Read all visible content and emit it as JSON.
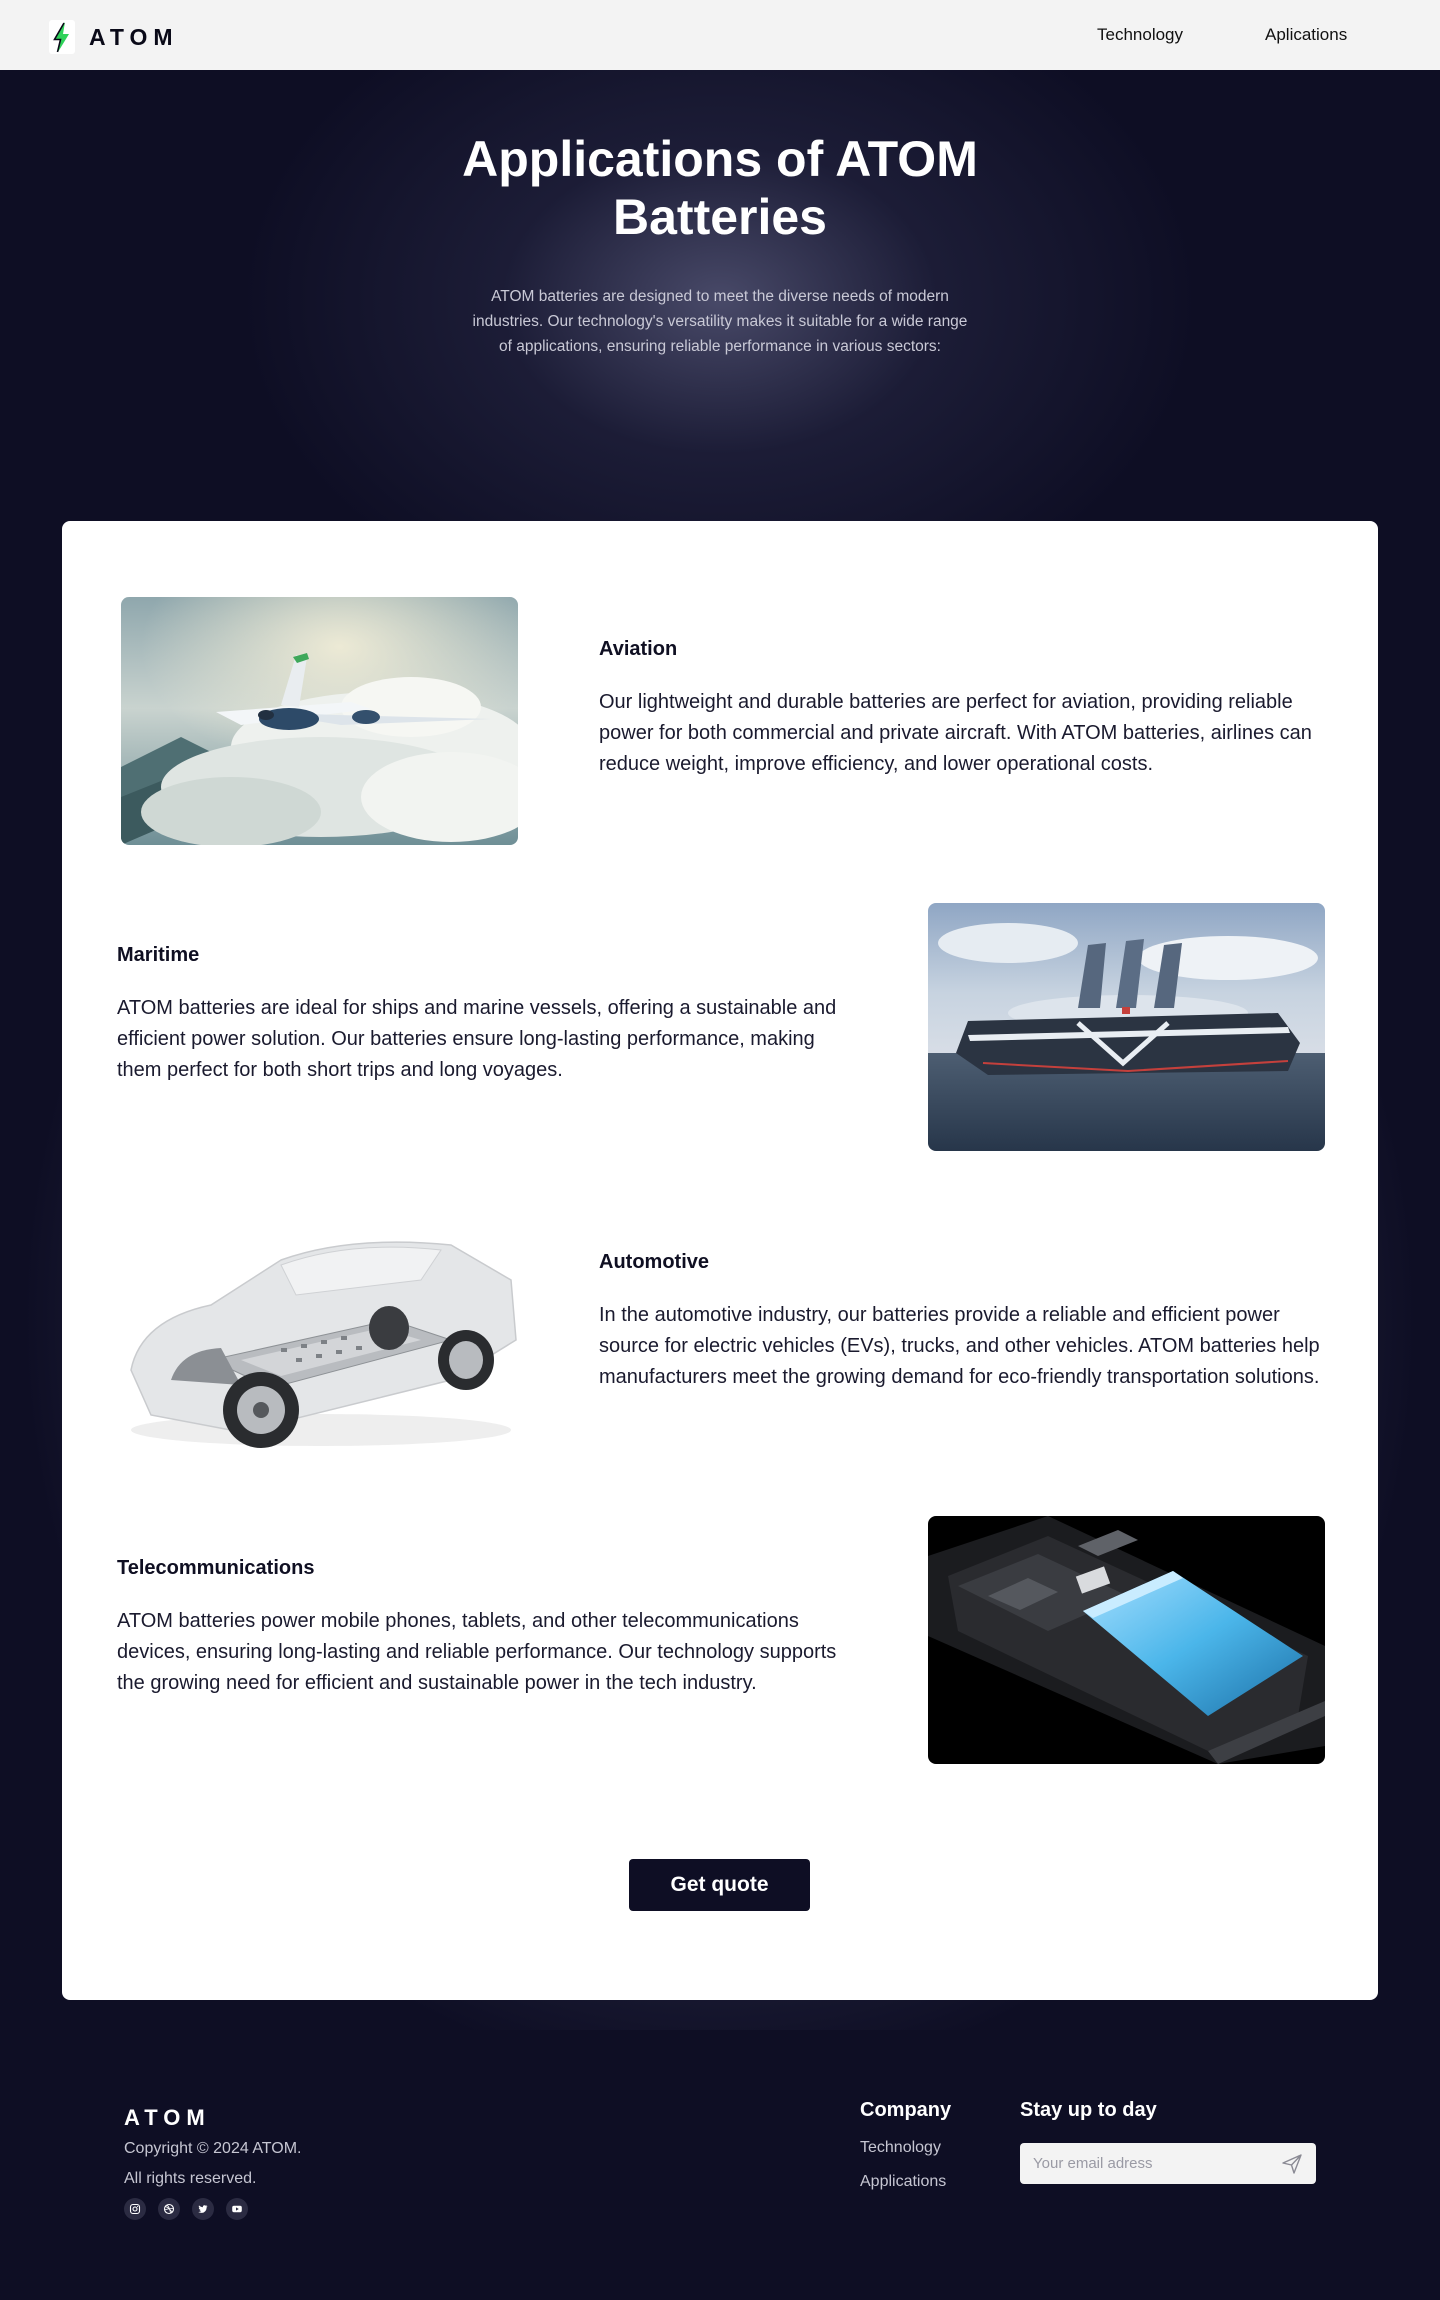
{
  "header": {
    "logo_text": "ATOM",
    "logo_icon": "lightning-bolt-icon",
    "nav": [
      "Technology",
      "Aplications"
    ]
  },
  "hero": {
    "title": "Applications of ATOM Batteries",
    "description": "ATOM batteries are designed to meet the diverse needs of modern industries. Our technology's versatility makes it suitable for a wide range of applications, ensuring reliable performance in various sectors:"
  },
  "sections": [
    {
      "title": "Aviation",
      "body": "Our lightweight and durable batteries are perfect for aviation, providing reliable power for both commercial and private aircraft. With ATOM batteries, airlines can reduce weight, improve efficiency, and lower operational costs.",
      "image": "electric-aircraft-image"
    },
    {
      "title": "Maritime",
      "body": "ATOM batteries are ideal for ships and marine vessels, offering a sustainable and efficient power solution. Our batteries ensure long-lasting performance, making them perfect for both short trips and long voyages.",
      "image": "electric-ship-image"
    },
    {
      "title": "Automotive",
      "body": "In the automotive industry, our batteries provide a reliable and efficient power source for electric vehicles (EVs), trucks, and other vehicles. ATOM batteries help manufacturers meet the growing demand for eco-friendly transportation solutions.",
      "image": "electric-car-chassis-image"
    },
    {
      "title": "Telecommunications",
      "body": "ATOM batteries power mobile phones, tablets, and other telecommunications devices, ensuring long-lasting and reliable performance. Our technology supports the growing need for efficient and sustainable power in the tech industry.",
      "image": "smartphone-battery-image"
    }
  ],
  "cta": {
    "label": "Get quote"
  },
  "footer": {
    "brand": "ATOM",
    "copyright": "Copyright © 2024 ATOM.",
    "rights": "All rights reserved.",
    "socials": [
      "instagram-icon",
      "dribbble-icon",
      "twitter-icon",
      "youtube-icon"
    ],
    "company_heading": "Company",
    "company_links": [
      "Technology",
      "Applications"
    ],
    "newsletter_heading": "Stay up to day",
    "email_placeholder": "Your email adress"
  },
  "colors": {
    "page_bg": "#0e0e24",
    "header_bg": "#f3f3f3",
    "card_bg": "#ffffff",
    "button_bg": "#0e0e24",
    "logo_accent": "#2fd25a"
  }
}
